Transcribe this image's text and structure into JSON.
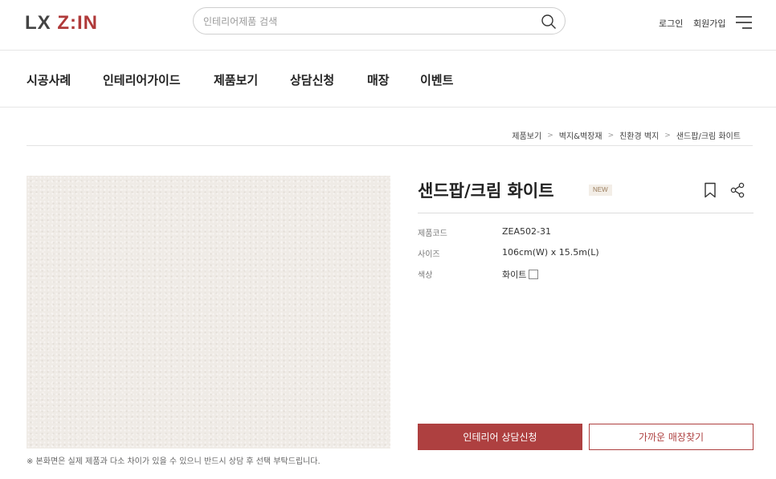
{
  "header": {
    "logo_main": "LX ",
    "logo_accent": "Z:IN",
    "search_placeholder": "인테리어제품 검색",
    "login_label": "로그인",
    "join_label": "회원가입"
  },
  "nav": [
    {
      "label": "시공사례"
    },
    {
      "label": "인테리어가이드"
    },
    {
      "label": "제품보기"
    },
    {
      "label": "상담신청"
    },
    {
      "label": "매장"
    },
    {
      "label": "이벤트"
    }
  ],
  "breadcrumb": [
    {
      "label": "제품보기"
    },
    {
      "label": "벽지&벽장재"
    },
    {
      "label": "친환경 벽지"
    },
    {
      "label": "샌드팝/크림 화이트"
    }
  ],
  "product": {
    "title": "샌드팝/크림 화이트",
    "badge": "NEW",
    "specs": [
      {
        "label": "제품코드",
        "value": "ZEA502-31"
      },
      {
        "label": "사이즈",
        "value": "106cm(W) x 15.5m(L)"
      },
      {
        "label": "색상",
        "value": "화이트"
      }
    ],
    "swatch_color": "#ffffff",
    "notice": "※ 본화면은 실제 제품과 다소 차이가 있을 수 있으니 반드시 상담 후 선택 부탁드립니다."
  },
  "actions": {
    "consult_label": "인테리어 상담신청",
    "store_label": "가까운 매장찾기"
  },
  "colors": {
    "brand": "#ae4040",
    "texture": "#efebe6"
  }
}
